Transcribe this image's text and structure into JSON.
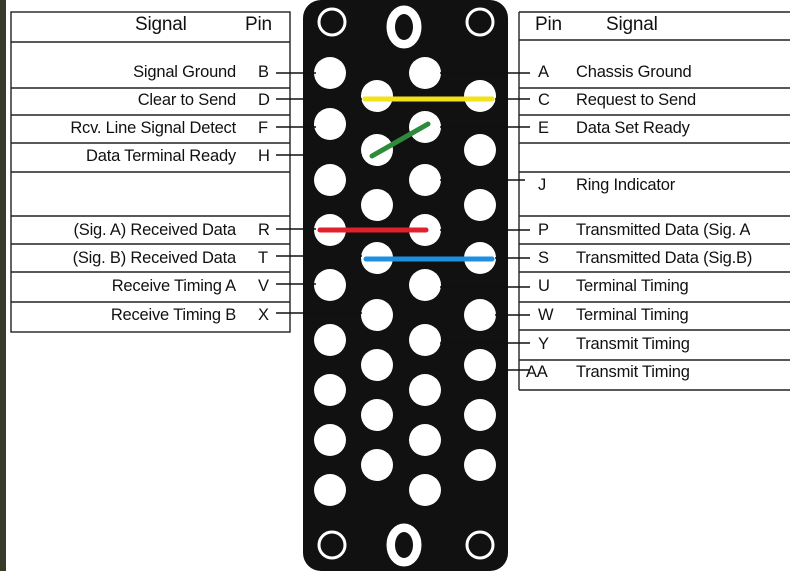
{
  "left_table": {
    "header_signal": "Signal",
    "header_pin": "Pin",
    "rows": [
      {
        "signal": "Signal Ground",
        "pin": "B"
      },
      {
        "signal": "Clear to Send",
        "pin": "D"
      },
      {
        "signal": "Rcv. Line Signal Detect",
        "pin": "F"
      },
      {
        "signal": "Data Terminal Ready",
        "pin": "H"
      },
      {
        "signal": "",
        "pin": ""
      },
      {
        "signal": "(Sig. A) Received Data",
        "pin": "R"
      },
      {
        "signal": "(Sig. B) Received Data",
        "pin": "T"
      },
      {
        "signal": "Receive Timing A",
        "pin": "V"
      },
      {
        "signal": "Receive Timing B",
        "pin": "X"
      }
    ]
  },
  "right_table": {
    "header_pin": "Pin",
    "header_signal": "Signal",
    "rows": [
      {
        "pin": "A",
        "signal": "Chassis Ground"
      },
      {
        "pin": "C",
        "signal": "Request to Send"
      },
      {
        "pin": "E",
        "signal": "Data Set Ready"
      },
      {
        "pin": "J",
        "signal": "Ring Indicator"
      },
      {
        "pin": "P",
        "signal": "Transmitted Data (Sig. A"
      },
      {
        "pin": "S",
        "signal": "Transmitted Data (Sig.B)"
      },
      {
        "pin": "U",
        "signal": "Terminal Timing"
      },
      {
        "pin": "W",
        "signal": "Terminal Timing"
      },
      {
        "pin": "Y",
        "signal": "Transmit Timing"
      },
      {
        "pin": "AA",
        "signal": "Transmit Timing"
      }
    ]
  },
  "colors": {
    "connector_body": "#111111",
    "pin_fill": "#ffffff",
    "jumper_yellow": "#f2e21a",
    "jumper_green": "#2e8b3a",
    "jumper_red": "#e0202a",
    "jumper_blue": "#1e90e0"
  }
}
